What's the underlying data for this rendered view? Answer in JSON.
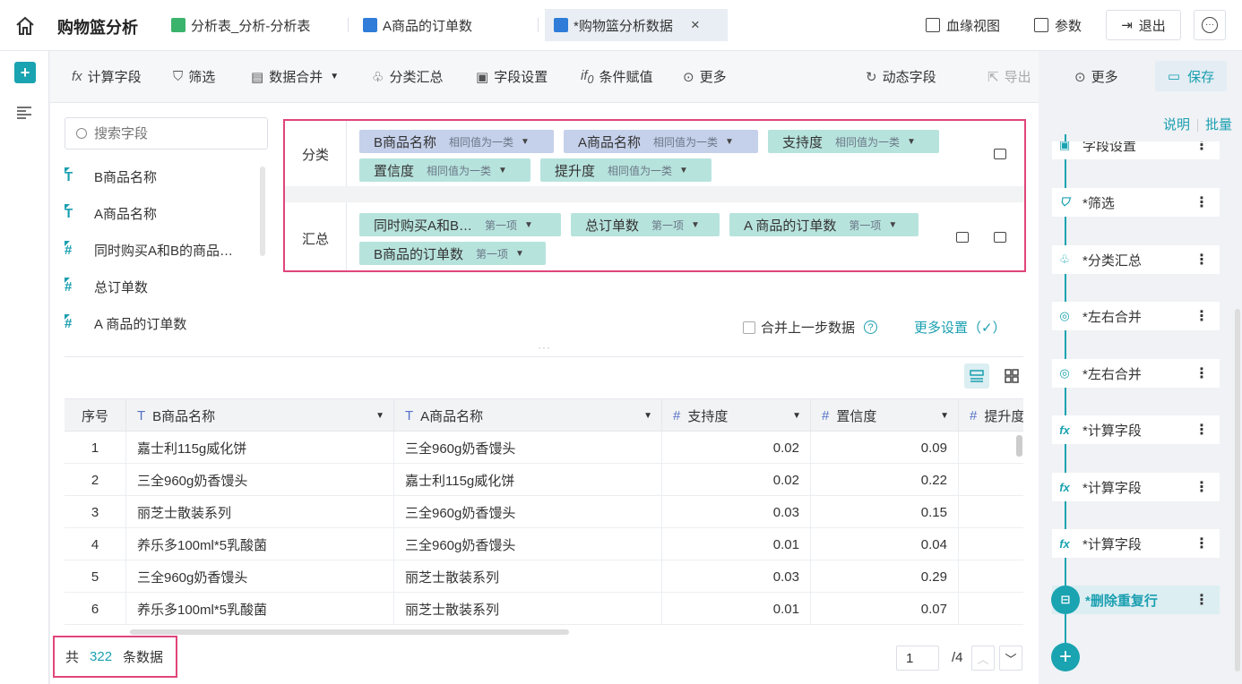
{
  "header": {
    "app_title": "购物篮分析",
    "tabs": [
      {
        "label": "分析表_分析-分析表",
        "icon": "table-icon"
      },
      {
        "label": "A商品的订单数",
        "icon": "line-chart-icon"
      },
      {
        "label": "*购物篮分析数据",
        "icon": "line-chart-icon",
        "active": true
      }
    ],
    "lineage_label": "血缘视图",
    "params_label": "参数",
    "exit_label": "退出"
  },
  "toolbar": {
    "calc_field": "计算字段",
    "filter": "筛选",
    "data_merge": "数据合并",
    "group_summary": "分类汇总",
    "field_settings": "字段设置",
    "conditional": "条件赋值",
    "more": "更多",
    "dynamic_field": "动态字段",
    "export": "导出",
    "more_right": "更多",
    "save": "保存"
  },
  "fields": {
    "search_placeholder": "搜索字段",
    "items": [
      {
        "label": "B商品名称",
        "type": "T"
      },
      {
        "label": "A商品名称",
        "type": "T"
      },
      {
        "label": "同时购买A和B的商品…",
        "type": "#"
      },
      {
        "label": "总订单数",
        "type": "#"
      },
      {
        "label": "A 商品的订单数",
        "type": "#"
      }
    ]
  },
  "config": {
    "category_label": "分类",
    "summary_label": "汇总",
    "category_chips": [
      {
        "name": "B商品名称",
        "sub": "相同值为一类"
      },
      {
        "name": "A商品名称",
        "sub": "相同值为一类"
      },
      {
        "name": "支持度",
        "sub": "相同值为一类"
      },
      {
        "name": "置信度",
        "sub": "相同值为一类"
      },
      {
        "name": "提升度",
        "sub": "相同值为一类"
      }
    ],
    "summary_chips": [
      {
        "name": "同时购买A和B…",
        "sub": "第一项"
      },
      {
        "name": "总订单数",
        "sub": "第一项"
      },
      {
        "name": "A 商品的订单数",
        "sub": "第一项"
      },
      {
        "name": "B商品的订单数",
        "sub": "第一项"
      }
    ],
    "merge_label": "合并上一步数据",
    "more_settings": "更多设置（✓）"
  },
  "table": {
    "headers": [
      "序号",
      "B商品名称",
      "A商品名称",
      "支持度",
      "置信度",
      "提升度"
    ],
    "rows": [
      {
        "idx": "1",
        "b": "嘉士利115g威化饼",
        "a": "三全960g奶香馒头",
        "support": "0.02",
        "confidence": "0.09"
      },
      {
        "idx": "2",
        "b": "三全960g奶香馒头",
        "a": "嘉士利115g威化饼",
        "support": "0.02",
        "confidence": "0.22"
      },
      {
        "idx": "3",
        "b": "丽芝士散装系列",
        "a": "三全960g奶香馒头",
        "support": "0.03",
        "confidence": "0.15"
      },
      {
        "idx": "4",
        "b": "养乐多100ml*5乳酸菌",
        "a": "三全960g奶香馒头",
        "support": "0.01",
        "confidence": "0.04"
      },
      {
        "idx": "5",
        "b": "三全960g奶香馒头",
        "a": "丽芝士散装系列",
        "support": "0.03",
        "confidence": "0.29"
      },
      {
        "idx": "6",
        "b": "养乐多100ml*5乳酸菌",
        "a": "丽芝士散装系列",
        "support": "0.01",
        "confidence": "0.07"
      }
    ]
  },
  "footer": {
    "total_prefix": "共",
    "total_count": "322",
    "total_suffix": "条数据",
    "page": "1",
    "page_total": "/4"
  },
  "steps_panel": {
    "explain": "说明",
    "batch": "批量",
    "steps": [
      {
        "label": "字段设置",
        "icon": "field-settings-icon"
      },
      {
        "label": "*筛选",
        "icon": "filter-icon"
      },
      {
        "label": "*分类汇总",
        "icon": "group-icon"
      },
      {
        "label": "*左右合并",
        "icon": "join-icon"
      },
      {
        "label": "*左右合并",
        "icon": "join-icon"
      },
      {
        "label": "*计算字段",
        "icon": "fx-icon"
      },
      {
        "label": "*计算字段",
        "icon": "fx-icon"
      },
      {
        "label": "*计算字段",
        "icon": "fx-icon"
      },
      {
        "label": "*删除重复行",
        "icon": "dedupe-icon",
        "active": true
      }
    ]
  },
  "colors": {
    "accent": "#1aa3b0",
    "highlight": "#e0457b"
  }
}
